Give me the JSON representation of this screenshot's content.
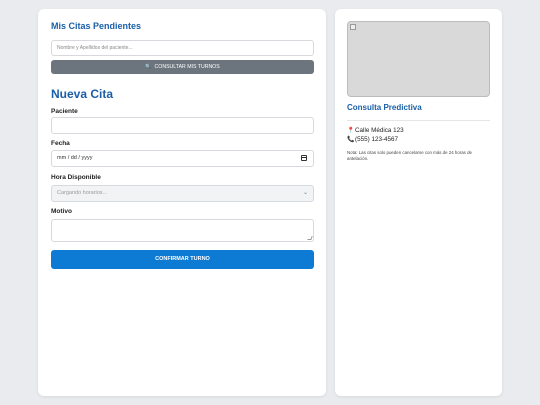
{
  "pending": {
    "title": "Mis Citas Pendientes",
    "search_placeholder": "Nombre y Apellidos del paciente...",
    "consult_button": "CONSULTAR MIS TURNOS",
    "consult_icon": "search-icon"
  },
  "new_appointment": {
    "title": "Nueva Cita",
    "patient_label": "Paciente",
    "patient_value": "",
    "date_label": "Fecha",
    "date_value": "mm / dd / yyyy",
    "time_label": "Hora Disponible",
    "time_value": "Cargando horarios...",
    "reason_label": "Motivo",
    "reason_value": "",
    "confirm_button": "CONFIRMAR TURNO"
  },
  "info": {
    "title": "Consulta Predictiva",
    "address": "Calle Médica 123",
    "phone": "(555) 123-4567",
    "note": "Nota: Las citas solo pueden cancelarse con más de 24 horas de antelación.",
    "address_icon": "map-pin-icon",
    "phone_icon": "phone-icon"
  },
  "colors": {
    "accent": "#1a5fa8",
    "primary_button": "#0d7bd3",
    "secondary_button": "#6c757d",
    "background": "#e9ebee"
  }
}
